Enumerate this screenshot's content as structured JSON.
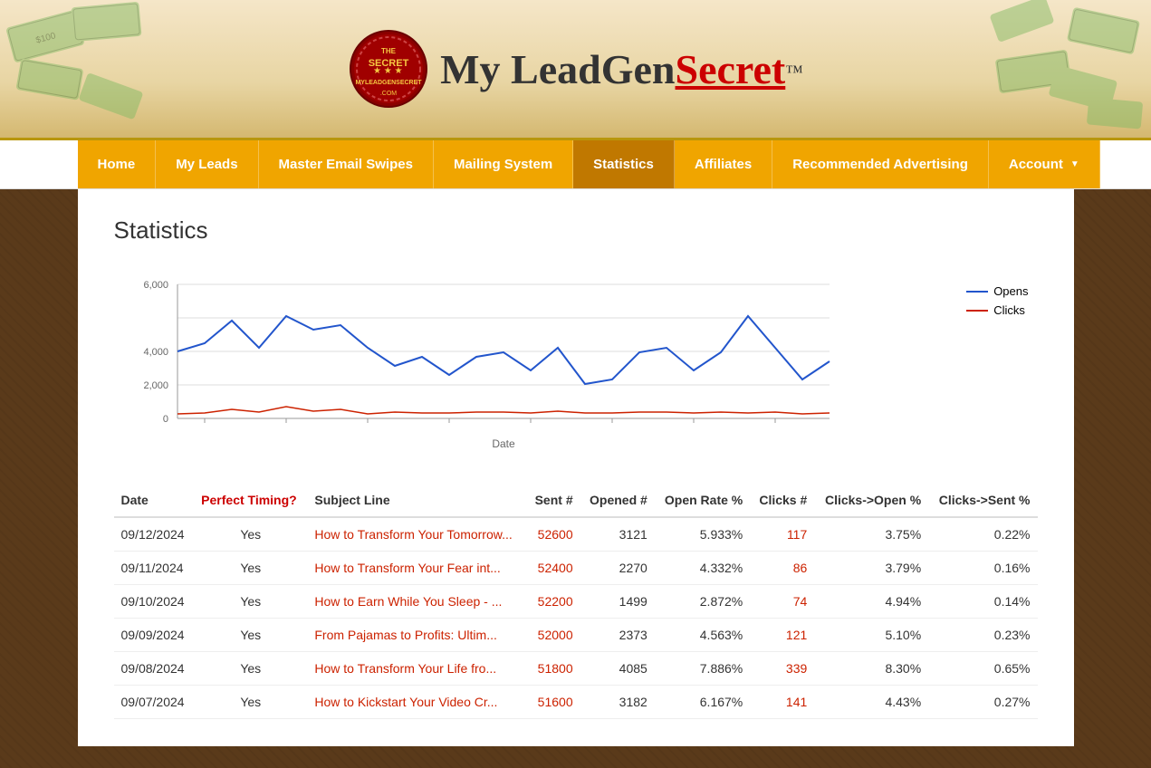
{
  "brand": {
    "name_part1": "My ",
    "name_part2": "LeadGen",
    "name_part3": "Secret",
    "tm": "™",
    "underline_text": "LeadGenSecret"
  },
  "nav": {
    "items": [
      {
        "label": "Home",
        "active": false,
        "id": "home"
      },
      {
        "label": "My Leads",
        "active": false,
        "id": "my-leads"
      },
      {
        "label": "Master Email Swipes",
        "active": false,
        "id": "master-email-swipes"
      },
      {
        "label": "Mailing System",
        "active": false,
        "id": "mailing-system"
      },
      {
        "label": "Statistics",
        "active": true,
        "id": "statistics"
      },
      {
        "label": "Affiliates",
        "active": false,
        "id": "affiliates"
      },
      {
        "label": "Recommended Advertising",
        "active": false,
        "id": "recommended-advertising"
      },
      {
        "label": "Account",
        "active": false,
        "id": "account",
        "has_dropdown": true
      }
    ]
  },
  "page": {
    "title": "Statistics"
  },
  "chart": {
    "x_label": "Date",
    "y_labels": [
      "0",
      "2,000",
      "4,000",
      "6,000"
    ],
    "legend": {
      "opens_label": "Opens",
      "clicks_label": "Clicks"
    }
  },
  "table": {
    "headers": [
      {
        "label": "Date",
        "class": ""
      },
      {
        "label": "Perfect Timing?",
        "class": "perfect-timing"
      },
      {
        "label": "Subject Line",
        "class": ""
      },
      {
        "label": "Sent #",
        "class": "right"
      },
      {
        "label": "Opened #",
        "class": "right"
      },
      {
        "label": "Open Rate %",
        "class": "right"
      },
      {
        "label": "Clicks #",
        "class": "right"
      },
      {
        "label": "Clicks->Open %",
        "class": "right"
      },
      {
        "label": "Clicks->Sent %",
        "class": "right"
      }
    ],
    "rows": [
      {
        "date": "09/12/2024",
        "perfect_timing": "Yes",
        "subject": "How to Transform Your Tomorrow...",
        "sent": "52600",
        "opened": "3121",
        "open_rate": "5.933%",
        "clicks": "117",
        "clicks_open": "3.75%",
        "clicks_sent": "0.22%"
      },
      {
        "date": "09/11/2024",
        "perfect_timing": "Yes",
        "subject": "How to Transform Your Fear int...",
        "sent": "52400",
        "opened": "2270",
        "open_rate": "4.332%",
        "clicks": "86",
        "clicks_open": "3.79%",
        "clicks_sent": "0.16%"
      },
      {
        "date": "09/10/2024",
        "perfect_timing": "Yes",
        "subject": "How to Earn While You Sleep - ...",
        "sent": "52200",
        "opened": "1499",
        "open_rate": "2.872%",
        "clicks": "74",
        "clicks_open": "4.94%",
        "clicks_sent": "0.14%"
      },
      {
        "date": "09/09/2024",
        "perfect_timing": "Yes",
        "subject": "From Pajamas to Profits: Ultim...",
        "sent": "52000",
        "opened": "2373",
        "open_rate": "4.563%",
        "clicks": "121",
        "clicks_open": "5.10%",
        "clicks_sent": "0.23%"
      },
      {
        "date": "09/08/2024",
        "perfect_timing": "Yes",
        "subject": "How to Transform Your Life fro...",
        "sent": "51800",
        "opened": "4085",
        "open_rate": "7.886%",
        "clicks": "339",
        "clicks_open": "8.30%",
        "clicks_sent": "0.65%"
      },
      {
        "date": "09/07/2024",
        "perfect_timing": "Yes",
        "subject": "How to Kickstart Your Video Cr...",
        "sent": "51600",
        "opened": "3182",
        "open_rate": "6.167%",
        "clicks": "141",
        "clicks_open": "4.43%",
        "clicks_sent": "0.27%"
      }
    ]
  }
}
